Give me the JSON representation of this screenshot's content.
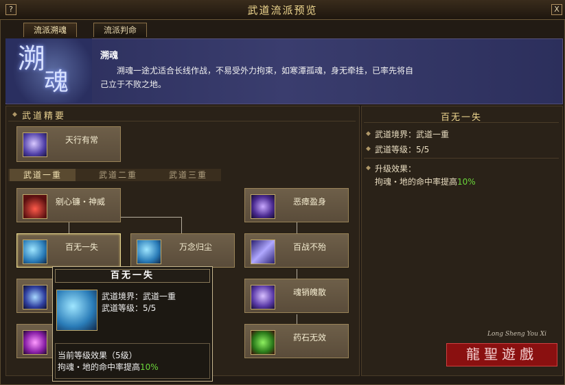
{
  "window": {
    "title": "武道流派预览",
    "help_label": "?",
    "close_label": "X"
  },
  "tabs": [
    {
      "label": "流派溯魂",
      "active": true
    },
    {
      "label": "流派判命",
      "active": false
    }
  ],
  "school": {
    "emblem_chars": [
      "溯",
      "魂"
    ],
    "name": "溯魂",
    "description": "溯魂一途尤适合长线作战，不易受外力拘束，如寒潭孤魂，身无牵挂，已率先将自己立于不败之地。"
  },
  "left": {
    "section_title": "武道精要",
    "essence_card": {
      "label": "天行有常",
      "icon": "purple-spirit-icon"
    },
    "subtabs": [
      {
        "label": "武道一重",
        "active": true
      },
      {
        "label": "武道二重",
        "active": false
      },
      {
        "label": "武道三重",
        "active": false
      }
    ],
    "skills": [
      {
        "label": "剜心镰・神威",
        "icon": "red-slash-icon"
      },
      {
        "label": "百无一失",
        "icon": "blue-spirit-icon"
      },
      {
        "label": "万念归尘",
        "icon": "blue-spirit-icon"
      },
      {
        "label": "恶瘴盈身",
        "icon": "purple-beast-icon"
      },
      {
        "label": "百战不殆",
        "icon": "purple-beam-icon"
      },
      {
        "label": "魂销魄散",
        "icon": "purple-soul-icon"
      },
      {
        "label": "药石无效",
        "icon": "green-hand-icon"
      }
    ]
  },
  "right": {
    "title": "百无一失",
    "realm_label": "武道境界：武道一重",
    "level_label": "武道等级：5/5",
    "effect_title": "升级效果：",
    "effect_text": "拘魂・地的命中率提高",
    "effect_value": "10%"
  },
  "tooltip": {
    "title": "百无一失",
    "realm_label": "武道境界：武道一重",
    "level_label": "武道等级：5/5",
    "current_effect_title": "当前等级效果（5级）",
    "effect_text": "拘魂・地的命中率提高",
    "effect_value": "10%"
  },
  "watermark": {
    "text": "龍聖遊戲",
    "subtext": "Long Sheng You Xi"
  },
  "colors": {
    "accent": "#f0d890",
    "highlight_green": "#6bd83a",
    "header_blue": "#3a3d6e"
  }
}
